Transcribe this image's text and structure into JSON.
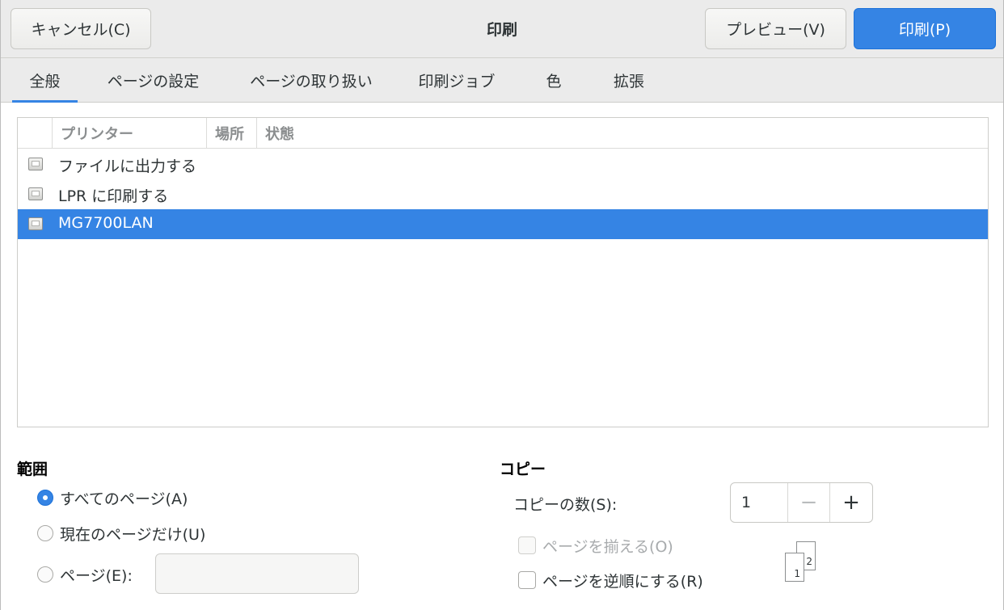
{
  "header": {
    "cancel_label": "キャンセル(C)",
    "title": "印刷",
    "preview_label": "プレビュー(V)",
    "print_label": "印刷(P)"
  },
  "tabs": [
    {
      "label": "全般",
      "active": true
    },
    {
      "label": "ページの設定"
    },
    {
      "label": "ページの取り扱い"
    },
    {
      "label": "印刷ジョブ"
    },
    {
      "label": "色"
    },
    {
      "label": "拡張"
    }
  ],
  "printer_list": {
    "columns": [
      "プリンター",
      "場所",
      "状態"
    ],
    "rows": [
      {
        "name": "ファイルに出力する",
        "icon": "printer-icon",
        "selected": false
      },
      {
        "name": "LPR に印刷する",
        "icon": "printer-icon",
        "selected": false
      },
      {
        "name": "MG7700LAN",
        "icon": "printer-icon",
        "selected": true
      }
    ]
  },
  "range": {
    "title": "範囲",
    "options": [
      "すべてのページ(A)",
      "現在のページだけ(U)",
      "ページ(E):"
    ],
    "selected_index": 0,
    "pages_value": ""
  },
  "copies": {
    "title": "コピー",
    "count_label": "コピーの数(S):",
    "count_value": "1",
    "minus_symbol": "−",
    "plus_symbol": "+",
    "collate_label": "ページを揃える(O)",
    "collate_enabled": false,
    "reverse_label": "ページを逆順にする(R)",
    "collate_pages": [
      "1",
      "2"
    ]
  },
  "colors": {
    "accent": "#3584e4",
    "headerbar": "#ebebeb"
  }
}
